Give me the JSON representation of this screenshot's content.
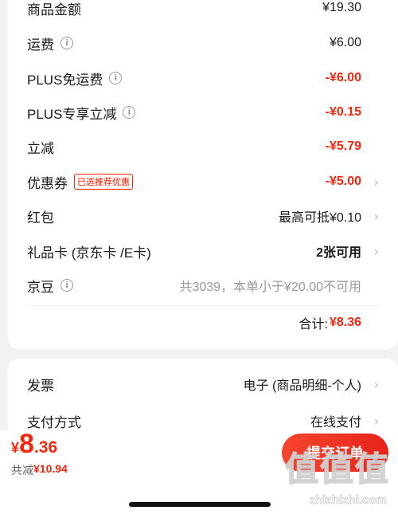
{
  "price_card": {
    "goods_amount": {
      "label": "商品金额",
      "value": "¥19.30"
    },
    "shipping": {
      "label": "运费",
      "value": "¥6.00"
    },
    "plus_free_shipping": {
      "label": "PLUS免运费",
      "value": "-¥6.00"
    },
    "plus_exclusive_discount": {
      "label": "PLUS专享立减",
      "value": "-¥0.15"
    },
    "instant_discount": {
      "label": "立减",
      "value": "-¥5.79"
    },
    "coupon": {
      "label": "优惠券",
      "tag": "已选推荐优惠",
      "value": "-¥5.00"
    },
    "red_packet": {
      "label": "红包",
      "value": "最高可抵¥0.10"
    },
    "gift_card": {
      "label": "礼品卡 (京东卡 /E卡)",
      "value": "2张可用"
    },
    "jingdou": {
      "label": "京豆",
      "value": "共3039，本单小于¥20.00不可用"
    },
    "total": {
      "label": "合计:",
      "value": "¥8.36"
    }
  },
  "invoice_card": {
    "invoice": {
      "label": "发票",
      "value": "电子 (商品明细-个人)"
    },
    "payment": {
      "label": "支付方式",
      "value": "在线支付"
    }
  },
  "bottom_bar": {
    "currency": "¥",
    "price_integer": "8",
    "price_decimal": ".36",
    "saved_label": "共减",
    "saved_value": "¥10.94",
    "submit_label": "提交订单"
  },
  "watermark": {
    "text": "值值值",
    "url": "zhizhizhi.com"
  },
  "colors": {
    "accent_red": "#f2270c",
    "background": "#f2f2f2",
    "card": "#ffffff"
  },
  "icons": {
    "info": "info-circle-icon",
    "chevron": "chevron-right-icon"
  }
}
